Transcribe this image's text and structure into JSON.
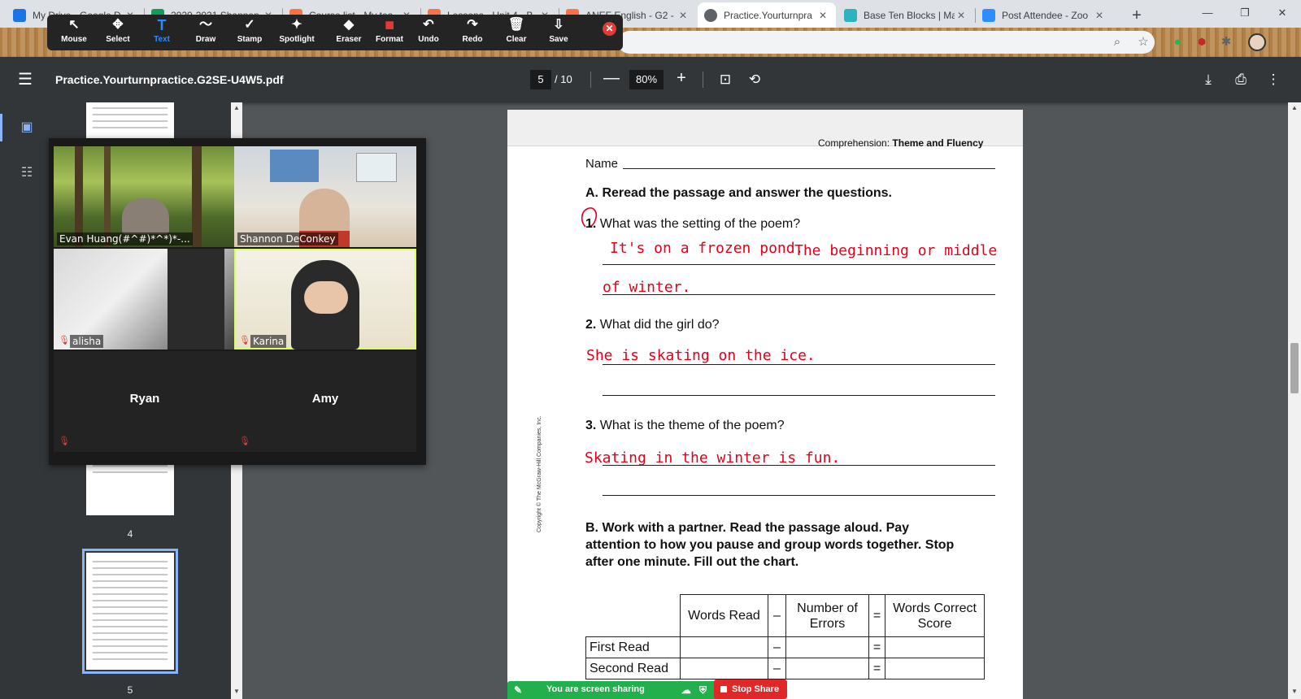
{
  "browser": {
    "tabs": [
      {
        "title": "My Drive - Google D",
        "fav": "#1a73e8",
        "icon": "drive-icon"
      },
      {
        "title": "2020-2021 Shannon",
        "fav": "#0f9d58",
        "icon": "sheets-icon"
      },
      {
        "title": "Course list - My tea",
        "fav": "#ff7043",
        "icon": "course-icon"
      },
      {
        "title": "Lessons - Unit 4 - B",
        "fav": "#ff7043",
        "icon": "lesson-icon"
      },
      {
        "title": "ANEF English - G2 -",
        "fav": "#ff7043",
        "icon": "course-icon"
      },
      {
        "title": "Practice.Yourturnpra",
        "fav": "#5f6368",
        "icon": "globe-icon"
      },
      {
        "title": "Base Ten Blocks | Ma",
        "fav": "#2bb3c0",
        "icon": "blocks-icon"
      },
      {
        "title": "Post Attendee - Zoo",
        "fav": "#2d8cff",
        "icon": "zoom-icon"
      }
    ],
    "new_tab": "+",
    "window_controls": {
      "minimize": "—",
      "restore": "❐",
      "close": "✕"
    }
  },
  "annotation_toolbar": {
    "tools": [
      {
        "label": "Mouse",
        "glyph": "↖",
        "icon": "mouse-icon"
      },
      {
        "label": "Select",
        "glyph": "✥",
        "icon": "select-icon"
      },
      {
        "label": "Text",
        "glyph": "T",
        "icon": "text-icon"
      },
      {
        "label": "Draw",
        "glyph": "〜",
        "icon": "draw-icon"
      },
      {
        "label": "Stamp",
        "glyph": "✓",
        "icon": "stamp-icon"
      },
      {
        "label": "Spotlight",
        "glyph": "✦",
        "icon": "spotlight-icon"
      },
      {
        "label": "Eraser",
        "glyph": "◆",
        "icon": "eraser-icon"
      },
      {
        "label": "Format",
        "glyph": "■",
        "icon": "format-icon"
      },
      {
        "label": "Undo",
        "glyph": "↶",
        "icon": "undo-icon"
      },
      {
        "label": "Redo",
        "glyph": "↷",
        "icon": "redo-icon"
      },
      {
        "label": "Clear",
        "glyph": "🗑",
        "icon": "clear-icon"
      },
      {
        "label": "Save",
        "glyph": "⇩",
        "icon": "save-icon"
      }
    ],
    "selected": "Text",
    "format_color": "#e53935",
    "close_glyph": "✕"
  },
  "pdf_viewer": {
    "title": "Practice.Yourturnpractice.G2SE-U4W5.pdf",
    "current_page": "5",
    "total_pages": "/ 10",
    "zoom": "80%",
    "zoom_out": "—",
    "zoom_in": "+",
    "thumb_numbers": [
      "4",
      "5"
    ]
  },
  "worksheet": {
    "header_prefix": "Comprehension:",
    "header_bold": "Theme and Fluency",
    "name_label": "Name",
    "section_a": "A. Reread the passage and answer the questions.",
    "questions": [
      {
        "num": "1.",
        "text": "What was the setting of the poem?"
      },
      {
        "num": "2.",
        "text": "What did the girl do?"
      },
      {
        "num": "3.",
        "text": "What is the theme of the poem?"
      }
    ],
    "answers": {
      "q1_line1a": "It's on a frozen pond.",
      "q1_line1b": "The beginning or middle",
      "q1_line2": "of winter.",
      "q2": "She is skating on the ice.",
      "q3": "Skating in the winter is fun."
    },
    "section_b_lines": [
      "B. Work with a partner. Read the passage aloud. Pay",
      "attention to how you pause and group words together. Stop",
      "after one minute. Fill out the chart."
    ],
    "copyright": "Copyright © The McGraw-Hill Companies, Inc.",
    "chart": {
      "headers": [
        "Words Read",
        "–",
        "Number of Errors",
        "=",
        "Words Correct Score"
      ],
      "rows": [
        {
          "label": "First Read",
          "minus": "–",
          "equals": "="
        },
        {
          "label": "Second Read",
          "minus": "–",
          "equals": "="
        }
      ]
    }
  },
  "zoom_panel": {
    "participants": [
      {
        "name": "Evan Huang(#^#)*^*)*-...",
        "video": true,
        "muted": false
      },
      {
        "name": "Shannon DeConkey",
        "video": true,
        "muted": false
      },
      {
        "name": "alisha",
        "video": true,
        "muted": true
      },
      {
        "name": "Karina",
        "video": true,
        "muted": true,
        "active_speaker": true
      },
      {
        "name": "Ryan",
        "video": false,
        "muted": true
      },
      {
        "name": "Amy",
        "video": false,
        "muted": true
      }
    ]
  },
  "share_bar": {
    "status": "You are screen sharing",
    "stop_label": "Stop Share"
  }
}
